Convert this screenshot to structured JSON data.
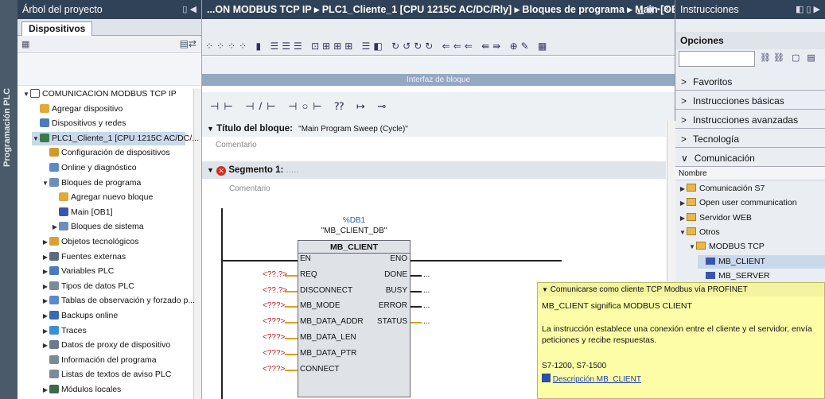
{
  "left_strip": {
    "label": "Programación PLC"
  },
  "project_tree": {
    "title": "Árbol del proyecto",
    "tab": "Dispositivos",
    "items": [
      {
        "label": "COMUNICACION MODBUS TCP IP",
        "depth": 0,
        "arrow": "▼",
        "icon": "project-icon"
      },
      {
        "label": "Agregar dispositivo",
        "depth": 1,
        "arrow": "",
        "icon": "add-device-icon"
      },
      {
        "label": "Dispositivos y redes",
        "depth": 1,
        "arrow": "",
        "icon": "network-icon"
      },
      {
        "label": "PLC1_Cliente_1 [CPU 1215C AC/DC/...",
        "depth": 1,
        "arrow": "▼",
        "icon": "plc-icon",
        "selected": true
      },
      {
        "label": "Configuración de dispositivos",
        "depth": 2,
        "arrow": "",
        "icon": "config-icon"
      },
      {
        "label": "Online y diagnóstico",
        "depth": 2,
        "arrow": "",
        "icon": "diag-icon"
      },
      {
        "label": "Bloques de programa",
        "depth": 2,
        "arrow": "▼",
        "icon": "folder-icon"
      },
      {
        "label": "Agregar nuevo bloque",
        "depth": 3,
        "arrow": "",
        "icon": "add-block-icon"
      },
      {
        "label": "Main [OB1]",
        "depth": 3,
        "arrow": "",
        "icon": "ob-icon"
      },
      {
        "label": "Bloques de sistema",
        "depth": 3,
        "arrow": "▶",
        "icon": "folder-icon"
      },
      {
        "label": "Objetos tecnológicos",
        "depth": 2,
        "arrow": "▶",
        "icon": "tech-icon"
      },
      {
        "label": "Fuentes externas",
        "depth": 2,
        "arrow": "▶",
        "icon": "source-icon"
      },
      {
        "label": "Variables PLC",
        "depth": 2,
        "arrow": "▶",
        "icon": "tag-icon"
      },
      {
        "label": "Tipos de datos PLC",
        "depth": 2,
        "arrow": "▶",
        "icon": "type-icon"
      },
      {
        "label": "Tablas de observación y forzado p...",
        "depth": 2,
        "arrow": "▶",
        "icon": "watch-icon"
      },
      {
        "label": "Backups online",
        "depth": 2,
        "arrow": "▶",
        "icon": "backup-icon"
      },
      {
        "label": "Traces",
        "depth": 2,
        "arrow": "▶",
        "icon": "trace-icon"
      },
      {
        "label": "Datos de proxy de dispositivo",
        "depth": 2,
        "arrow": "▶",
        "icon": "proxy-icon"
      },
      {
        "label": "Información del programa",
        "depth": 2,
        "arrow": "",
        "icon": "info-icon"
      },
      {
        "label": "Listas de textos de aviso PLC",
        "depth": 2,
        "arrow": "",
        "icon": "list-icon"
      },
      {
        "label": "Módulos locales",
        "depth": 2,
        "arrow": "▶",
        "icon": "module-icon"
      }
    ]
  },
  "editor": {
    "breadcrumb": "...ON MODBUS TCP IP ▸ PLC1_Cliente_1 [CPU 1215C AC/DC/Rly] ▸ Bloques de programa ▸ Main [OB1]",
    "interface_label": "Interfaz de bloque",
    "block_title_label": "Título del bloque:",
    "block_title_value": "\"Main Program Sweep (Cycle)\"",
    "comment1": "Comentario",
    "segment_label": "Segmento 1:",
    "segment_dots": ".....",
    "comment2": "Comentario",
    "db_addr": "%DB1",
    "db_name": "\"MB_CLIENT_DB\"",
    "fb_name": "MB_CLIENT",
    "inputs": [
      "EN",
      "REQ",
      "DISCONNECT",
      "MB_MODE",
      "MB_DATA_ADDR",
      "MB_DATA_LEN",
      "MB_DATA_PTR",
      "CONNECT"
    ],
    "input_params": [
      "",
      "<??.?>",
      "<??.?>",
      "<???>",
      "<???>",
      "<???>",
      "<???>",
      "<???>"
    ],
    "outputs": [
      "ENO",
      "DONE",
      "BUSY",
      "ERROR",
      "STATUS"
    ],
    "output_params": [
      "",
      "...",
      "...",
      "...",
      "..."
    ]
  },
  "instructions": {
    "title": "Instrucciones",
    "options": "Opciones",
    "sections": [
      {
        "label": "Favoritos",
        "arrow": ">"
      },
      {
        "label": "Instrucciones básicas",
        "arrow": ">"
      },
      {
        "label": "Instrucciones avanzadas",
        "arrow": ">"
      },
      {
        "label": "Tecnología",
        "arrow": ">"
      },
      {
        "label": "Comunicación",
        "arrow": "∨"
      }
    ],
    "column_header": "Nombre",
    "folders": [
      {
        "label": "Comunicación S7",
        "arrow": "▶",
        "depth": 0,
        "type": "folder"
      },
      {
        "label": "Open user communication",
        "arrow": "▶",
        "depth": 0,
        "type": "folder"
      },
      {
        "label": "Servidor WEB",
        "arrow": "▶",
        "depth": 0,
        "type": "folder"
      },
      {
        "label": "Otros",
        "arrow": "▼",
        "depth": 0,
        "type": "folder"
      },
      {
        "label": "MODBUS TCP",
        "arrow": "▼",
        "depth": 1,
        "type": "folder"
      },
      {
        "label": "MB_CLIENT",
        "arrow": "",
        "depth": 2,
        "type": "block",
        "selected": true
      },
      {
        "label": "MB_SERVER",
        "arrow": "",
        "depth": 2,
        "type": "block"
      }
    ]
  },
  "tooltip": {
    "title": "Comunicarse como cliente TCP Modbus vía PROFINET",
    "line1": "MB_CLIENT significa MODBUS CLIENT",
    "line2": "La instrucción establece una conexión entre el cliente y el servidor, envía peticiones y recibe respuestas.",
    "line3": "S7-1200, S7-1500",
    "link": "Descripción MB_CLIENT"
  },
  "colors": {
    "title_bar": "#304258",
    "fb_fill": "#dfe3e8",
    "tooltip": "#fdfda8",
    "link": "#1a3fb0"
  }
}
